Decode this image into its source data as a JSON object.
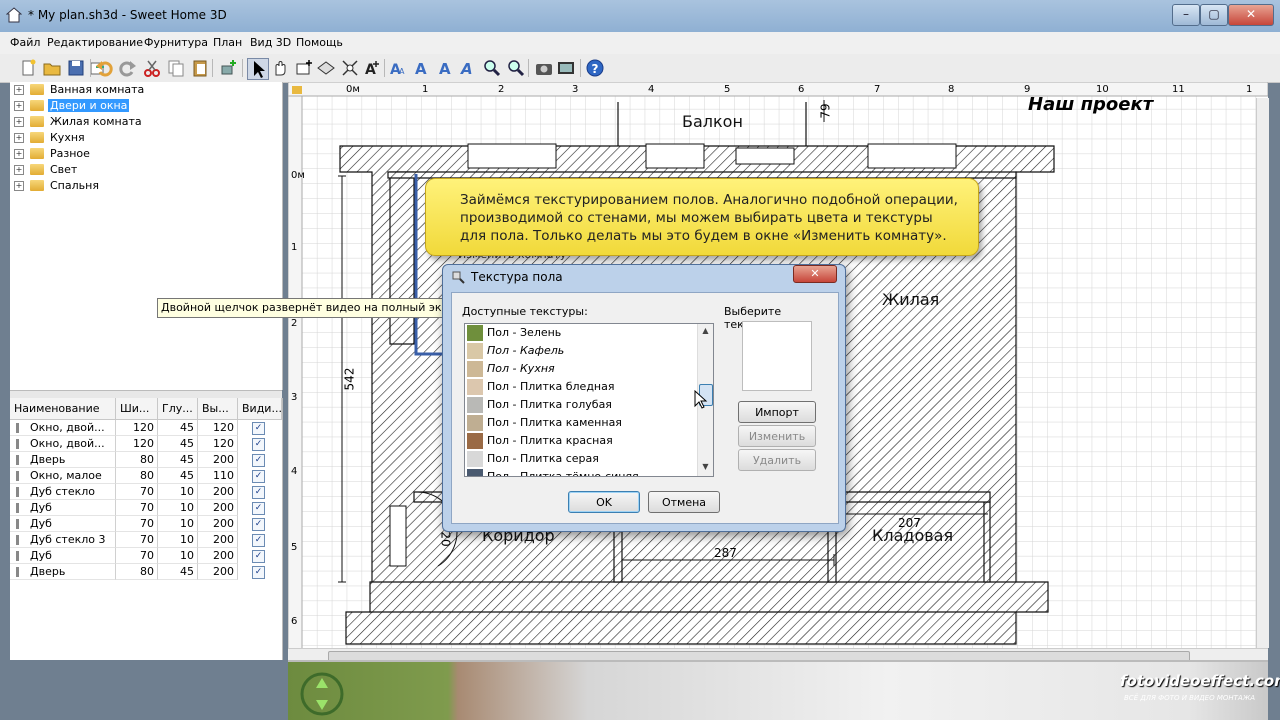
{
  "window": {
    "title": "* My plan.sh3d - Sweet Home 3D",
    "minimize": "–",
    "maximize": "▢",
    "close": "✕"
  },
  "menu": [
    "Файл",
    "Редактирование",
    "Фурнитура",
    "План",
    "Вид 3D",
    "Помощь"
  ],
  "toolbar_icons": [
    "new-icon",
    "open-icon",
    "save-icon",
    "cut-icon",
    "undo-icon",
    "redo-icon",
    "copy-icon",
    "paste-icon",
    "add-furniture-icon",
    "select-icon",
    "pan-icon",
    "create-walls-icon",
    "create-rooms-icon",
    "create-dimensions-icon",
    "add-text-icon",
    "text-style-icon",
    "zoom-in-icon",
    "zoom-out-icon",
    "photo-icon",
    "video-icon",
    "help-icon"
  ],
  "catalog": [
    {
      "label": "Ванная комната",
      "selected": false
    },
    {
      "label": "Двери и окна",
      "selected": true
    },
    {
      "label": "Жилая комната",
      "selected": false
    },
    {
      "label": "Кухня",
      "selected": false
    },
    {
      "label": "Разное",
      "selected": false
    },
    {
      "label": "Свет",
      "selected": false
    },
    {
      "label": "Спальня",
      "selected": false
    }
  ],
  "furniture_table": {
    "columns": [
      "Наименование",
      "Ши...",
      "Глу...",
      "Вы...",
      "Види..."
    ],
    "rows": [
      [
        "Окно, двой...",
        "120",
        "45",
        "120",
        true
      ],
      [
        "Окно, двой...",
        "120",
        "45",
        "120",
        true
      ],
      [
        "Дверь",
        "80",
        "45",
        "200",
        true
      ],
      [
        "Окно, малое",
        "80",
        "45",
        "110",
        true
      ],
      [
        "Дуб стекло",
        "70",
        "10",
        "200",
        true
      ],
      [
        "Дуб",
        "70",
        "10",
        "200",
        true
      ],
      [
        "Дуб",
        "70",
        "10",
        "200",
        true
      ],
      [
        "Дуб стекло 3",
        "70",
        "10",
        "200",
        true
      ],
      [
        "Дуб",
        "70",
        "10",
        "200",
        true
      ],
      [
        "Дверь",
        "80",
        "45",
        "200",
        true
      ]
    ]
  },
  "plan": {
    "ruler_top": [
      "0м",
      "1",
      "2",
      "3",
      "4",
      "5",
      "6",
      "7",
      "8",
      "9",
      "10",
      "11",
      "1"
    ],
    "ruler_left": [
      "0м",
      "1",
      "2",
      "3",
      "4",
      "5",
      "6"
    ],
    "project_title": "Наш проект",
    "rooms": {
      "balcony": "Балкон",
      "living": "Жилая",
      "corridor": "Коридор",
      "storage": "Кладовая"
    },
    "dims": {
      "d79": "79",
      "d542": "542",
      "d287": "287",
      "d207": "207",
      "d20": "20"
    },
    "modify_room_ghost": "Изменить комнату"
  },
  "callout": "Займёмся текстурированием полов. Аналогично подобной операции, производимой со стенами, мы можем выбирать цвета и текстуры для пола. Только делать мы это будем в окне «Изменить комнату».",
  "tooltip": "Двойной щелчок развернёт видео на полный экран",
  "dialog": {
    "title": "Текстура пола",
    "available_label": "Доступные текстуры:",
    "choose_label": "Выберите текстуру:",
    "textures": [
      {
        "label": "Пол - Зелень",
        "color": "#6f8f3c",
        "italic": false
      },
      {
        "label": "Пол - Кафель",
        "color": "#d9c8a6",
        "italic": true
      },
      {
        "label": "Пол - Кухня",
        "color": "#cdb896",
        "italic": true
      },
      {
        "label": "Пол - Плитка бледная",
        "color": "#dcc7ae",
        "italic": false
      },
      {
        "label": "Пол - Плитка голубая",
        "color": "#b9b9b6",
        "italic": false
      },
      {
        "label": "Пол - Плитка каменная",
        "color": "#bfae92",
        "italic": false
      },
      {
        "label": "Пол - Плитка красная",
        "color": "#9a6a45",
        "italic": false
      },
      {
        "label": "Пол - Плитка серая",
        "color": "#d8d8d8",
        "italic": false
      },
      {
        "label": "Пол - Плитка тёмно-синяя",
        "color": "#4a5a70",
        "italic": false
      }
    ],
    "import": "Импорт",
    "modify": "Изменить",
    "delete": "Удалить",
    "ok": "OK",
    "cancel": "Отмена"
  },
  "watermark": {
    "site": "fotovideoeffect.com",
    "tagline": "ВСЁ ДЛЯ ФОТО И ВИДЕО МОНТАЖА"
  }
}
